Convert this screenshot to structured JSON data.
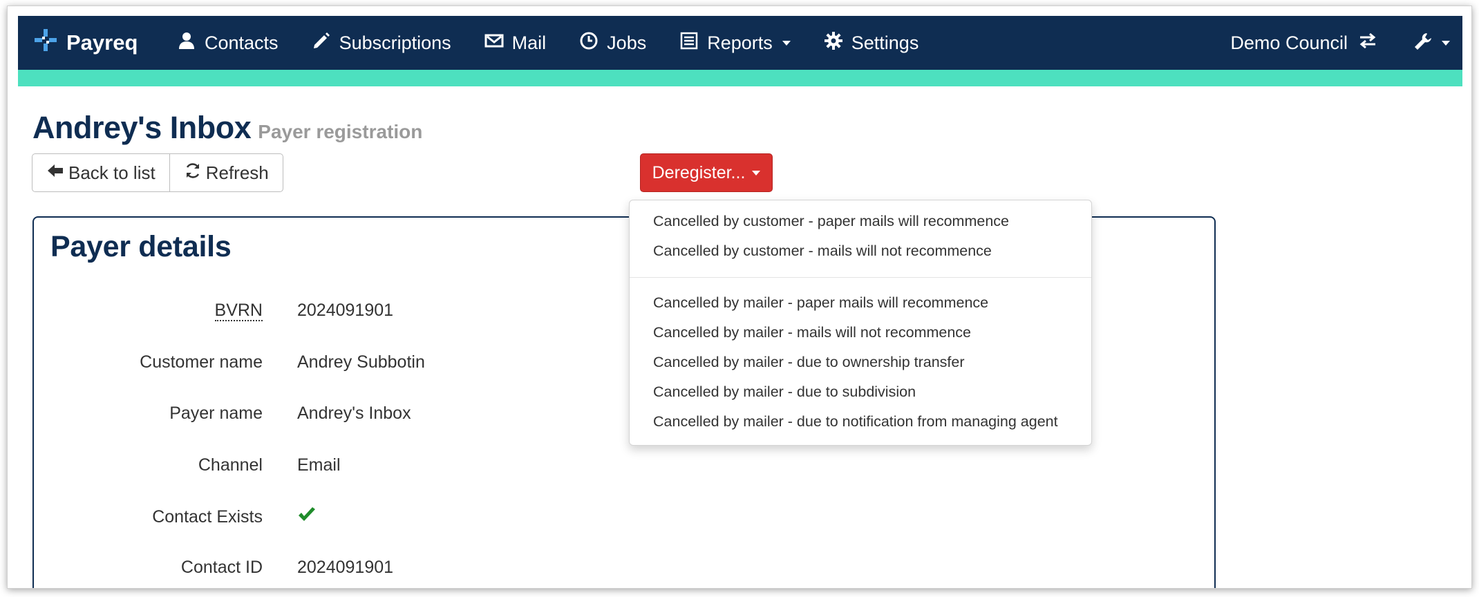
{
  "brand": {
    "name": "Payreq"
  },
  "nav": {
    "items": [
      {
        "label": "Contacts",
        "icon": "user-icon"
      },
      {
        "label": "Subscriptions",
        "icon": "pencil-icon"
      },
      {
        "label": "Mail",
        "icon": "envelope-icon"
      },
      {
        "label": "Jobs",
        "icon": "clock-icon"
      },
      {
        "label": "Reports",
        "icon": "list-icon",
        "has_dropdown": true
      },
      {
        "label": "Settings",
        "icon": "gear-icon"
      }
    ],
    "council": "Demo Council"
  },
  "colors": {
    "navbar": "#0f2d52",
    "accent": "#4de0bf",
    "danger": "#d9312e",
    "success": "#1f8c2b"
  },
  "page": {
    "title": "Andrey's Inbox",
    "subtitle": "Payer registration"
  },
  "toolbar": {
    "back_label": "Back to list",
    "refresh_label": "Refresh",
    "deregister_label": "Deregister..."
  },
  "dropdown": {
    "group1": [
      "Cancelled by customer - paper mails will recommence",
      "Cancelled by customer - mails will not recommence"
    ],
    "group2": [
      "Cancelled by mailer - paper mails will recommence",
      "Cancelled by mailer - mails will not recommence",
      "Cancelled by mailer - due to ownership transfer",
      "Cancelled by mailer - due to subdivision",
      "Cancelled by mailer - due to notification from managing agent"
    ]
  },
  "details": {
    "title": "Payer details",
    "rows": [
      {
        "label": "BVRN",
        "value": "2024091901"
      },
      {
        "label": "Customer name",
        "value": "Andrey Subbotin"
      },
      {
        "label": "Payer name",
        "value": "Andrey's Inbox"
      },
      {
        "label": "Channel",
        "value": "Email"
      },
      {
        "label": "Contact Exists",
        "value": ""
      },
      {
        "label": "Contact ID",
        "value": "2024091901"
      }
    ]
  }
}
